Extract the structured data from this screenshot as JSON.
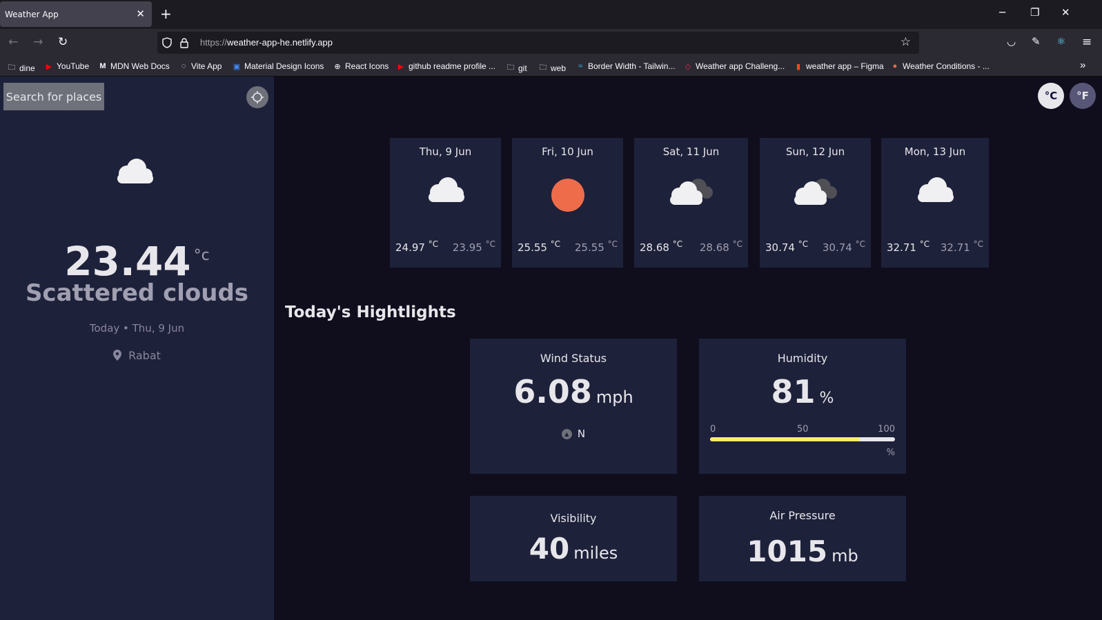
{
  "browser": {
    "tab_title": "Weather App",
    "tab_close": "✕",
    "new_tab": "+",
    "url_protocol": "https://",
    "url_host": "weather-app-he.netlify.app",
    "bookmarks": [
      {
        "label": "dine",
        "icon": "folder-icon"
      },
      {
        "label": "YouTube",
        "icon": "youtube-icon"
      },
      {
        "label": "MDN Web Docs",
        "icon": "mdn-icon"
      },
      {
        "label": "Vite App",
        "icon": "vite-icon"
      },
      {
        "label": "Material Design Icons",
        "icon": "mdi-icon"
      },
      {
        "label": "React Icons",
        "icon": "globe-icon"
      },
      {
        "label": "github readme profile ...",
        "icon": "youtube-icon"
      },
      {
        "label": "git",
        "icon": "folder-icon"
      },
      {
        "label": "web",
        "icon": "folder-icon"
      },
      {
        "label": "Border Width - Tailwin...",
        "icon": "tailwind-icon"
      },
      {
        "label": "Weather app Challeng...",
        "icon": "devchallenges-icon"
      },
      {
        "label": "weather app – Figma",
        "icon": "figma-icon"
      },
      {
        "label": "Weather Conditions - ...",
        "icon": "openweather-icon"
      }
    ]
  },
  "sidebar": {
    "search_label": "Search for places",
    "temperature": "23.44",
    "temp_unit": "°c",
    "condition": "Scattered clouds",
    "date": "Today • Thu, 9 Jun",
    "location": "Rabat"
  },
  "units": {
    "celsius": "°C",
    "fahrenheit": "°F"
  },
  "forecast": [
    {
      "day": "Thu, 9 Jun",
      "max": "24.97",
      "min": "23.95",
      "unit": "°C",
      "icon": "cloud-icon"
    },
    {
      "day": "Fri, 10 Jun",
      "max": "25.55",
      "min": "25.55",
      "unit": "°C",
      "icon": "sun-icon"
    },
    {
      "day": "Sat, 11 Jun",
      "max": "28.68",
      "min": "28.68",
      "unit": "°C",
      "icon": "heavy-cloud-icon"
    },
    {
      "day": "Sun, 12 Jun",
      "max": "30.74",
      "min": "30.74",
      "unit": "°C",
      "icon": "heavy-cloud-icon"
    },
    {
      "day": "Mon, 13 Jun",
      "max": "32.71",
      "min": "32.71",
      "unit": "°C",
      "icon": "cloud-icon"
    }
  ],
  "highlights": {
    "title": "Today's Hightlights",
    "wind": {
      "label": "Wind Status",
      "value": "6.08",
      "unit": "mph",
      "direction": "N"
    },
    "humidity": {
      "label": "Humidity",
      "value": "81",
      "unit": "%",
      "scale_min": "0",
      "scale_mid": "50",
      "scale_max": "100",
      "scale_unit": "%",
      "level": 0.81
    },
    "visibility": {
      "label": "Visibility",
      "value": "40",
      "unit": "miles"
    },
    "pressure": {
      "label": "Air Pressure",
      "value": "1015",
      "unit": "mb"
    }
  },
  "colors": {
    "accent_bar": "#ffec65",
    "sun": "#ef6c4a",
    "card_bg": "#1e213a",
    "page_bg": "#100e1d"
  }
}
